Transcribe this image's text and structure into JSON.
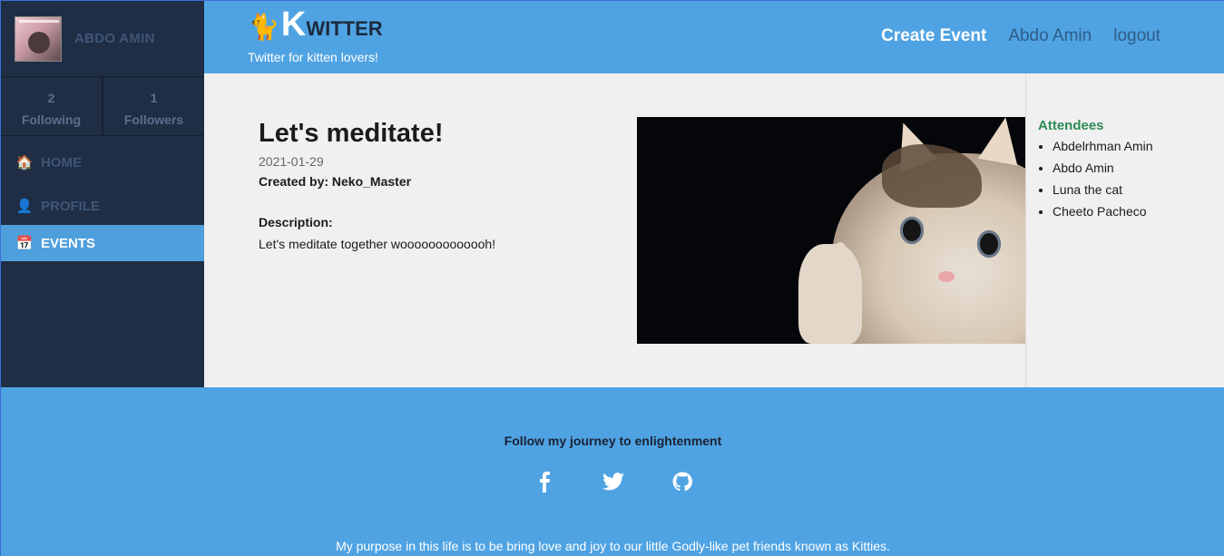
{
  "sidebar": {
    "user_name": "ABDO AMIN",
    "stats": [
      {
        "count": "2",
        "label": "Following"
      },
      {
        "count": "1",
        "label": "Followers"
      }
    ],
    "nav": [
      {
        "label": "HOME",
        "icon": "house-icon"
      },
      {
        "label": "PROFILE",
        "icon": "user-icon"
      },
      {
        "label": "EVENTS",
        "icon": "calendar-icon",
        "active": true
      }
    ]
  },
  "header": {
    "brand_initial": "K",
    "brand_rest": "WITTER",
    "tagline": "Twitter for kitten lovers!",
    "nav": {
      "create_event": "Create Event",
      "user": "Abdo Amin",
      "logout": "logout"
    }
  },
  "event": {
    "title": "Let's meditate!",
    "date": "2021-01-29",
    "created_by": "Created by: Neko_Master",
    "description_label": "Description:",
    "description": "Let's meditate together wooooooooooooh!"
  },
  "attendees": {
    "title": "Attendees",
    "names": [
      "Abdelrhman Amin",
      "Abdo Amin",
      "Luna the cat",
      "Cheeto Pacheco"
    ]
  },
  "footer": {
    "title": "Follow my journey to enlightenment",
    "socials": [
      "facebook-icon",
      "twitter-icon",
      "github-icon"
    ],
    "text": "My purpose in this life is to be bring love and joy to our little Godly-like pet friends known as Kitties."
  },
  "colors": {
    "header_blue": "#4fa3e3",
    "sidebar_dark": "#1f2e45",
    "attendees_green": "#2d8a56"
  }
}
